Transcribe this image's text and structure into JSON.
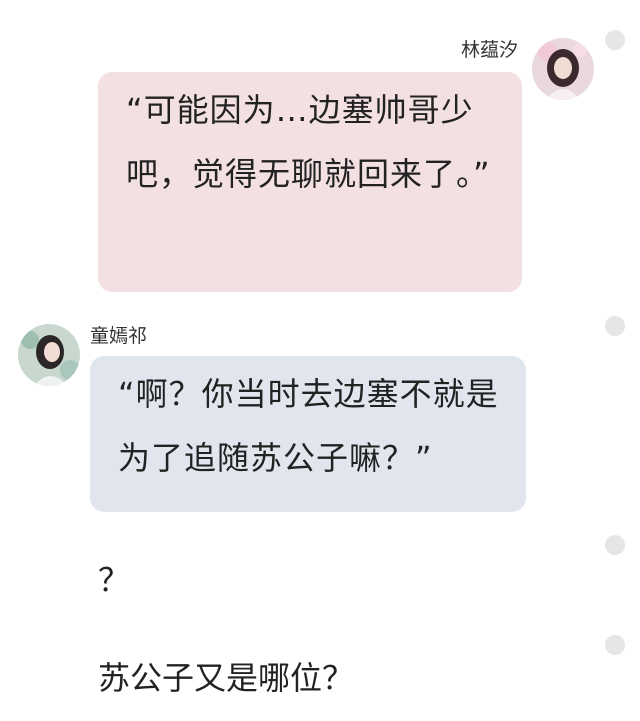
{
  "messages": [
    {
      "sender": "林蕴汐",
      "side": "right",
      "text": "“可能因为…边塞帅哥少吧，觉得无聊就回来了。”",
      "bubble_color": "#f2e0e2"
    },
    {
      "sender": "童嫣祁",
      "side": "left",
      "text": "“啊？你当时去边塞不就是为了追随苏公子嘛？”",
      "bubble_color": "#e1e6ee"
    }
  ],
  "narration": [
    "？",
    "苏公子又是哪位？"
  ],
  "colors": {
    "background": "#ffffff",
    "indicator_dot": "#e6e6e6"
  }
}
